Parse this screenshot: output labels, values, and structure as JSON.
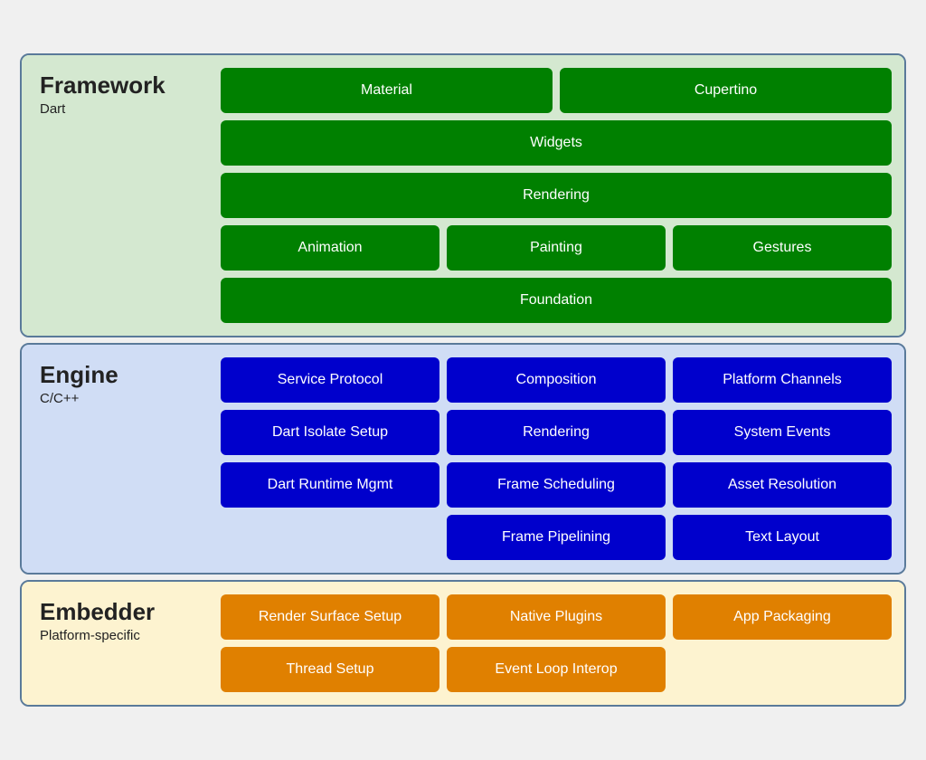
{
  "framework": {
    "title": "Framework",
    "subtitle": "Dart",
    "rows": [
      [
        {
          "label": "Material",
          "span": 1
        },
        {
          "label": "Cupertino",
          "span": 1
        }
      ],
      [
        {
          "label": "Widgets",
          "span": 2
        }
      ],
      [
        {
          "label": "Rendering",
          "span": 2
        }
      ],
      [
        {
          "label": "Animation",
          "span": 1
        },
        {
          "label": "Painting",
          "span": 1
        },
        {
          "label": "Gestures",
          "span": 1
        }
      ],
      [
        {
          "label": "Foundation",
          "span": 2
        }
      ]
    ]
  },
  "engine": {
    "title": "Engine",
    "subtitle": "C/C++",
    "rows": [
      [
        {
          "label": "Service Protocol"
        },
        {
          "label": "Composition"
        },
        {
          "label": "Platform Channels"
        }
      ],
      [
        {
          "label": "Dart Isolate Setup"
        },
        {
          "label": "Rendering"
        },
        {
          "label": "System Events"
        }
      ],
      [
        {
          "label": "Dart Runtime Mgmt"
        },
        {
          "label": "Frame Scheduling"
        },
        {
          "label": "Asset Resolution"
        }
      ],
      [
        {
          "label": "",
          "empty": true
        },
        {
          "label": "Frame Pipelining"
        },
        {
          "label": "Text Layout"
        }
      ]
    ]
  },
  "embedder": {
    "title": "Embedder",
    "subtitle": "Platform-specific",
    "rows": [
      [
        {
          "label": "Render Surface Setup"
        },
        {
          "label": "Native Plugins"
        },
        {
          "label": "App Packaging"
        }
      ],
      [
        {
          "label": "Thread Setup"
        },
        {
          "label": "Event Loop Interop"
        },
        {
          "label": "",
          "empty": true
        }
      ]
    ]
  }
}
